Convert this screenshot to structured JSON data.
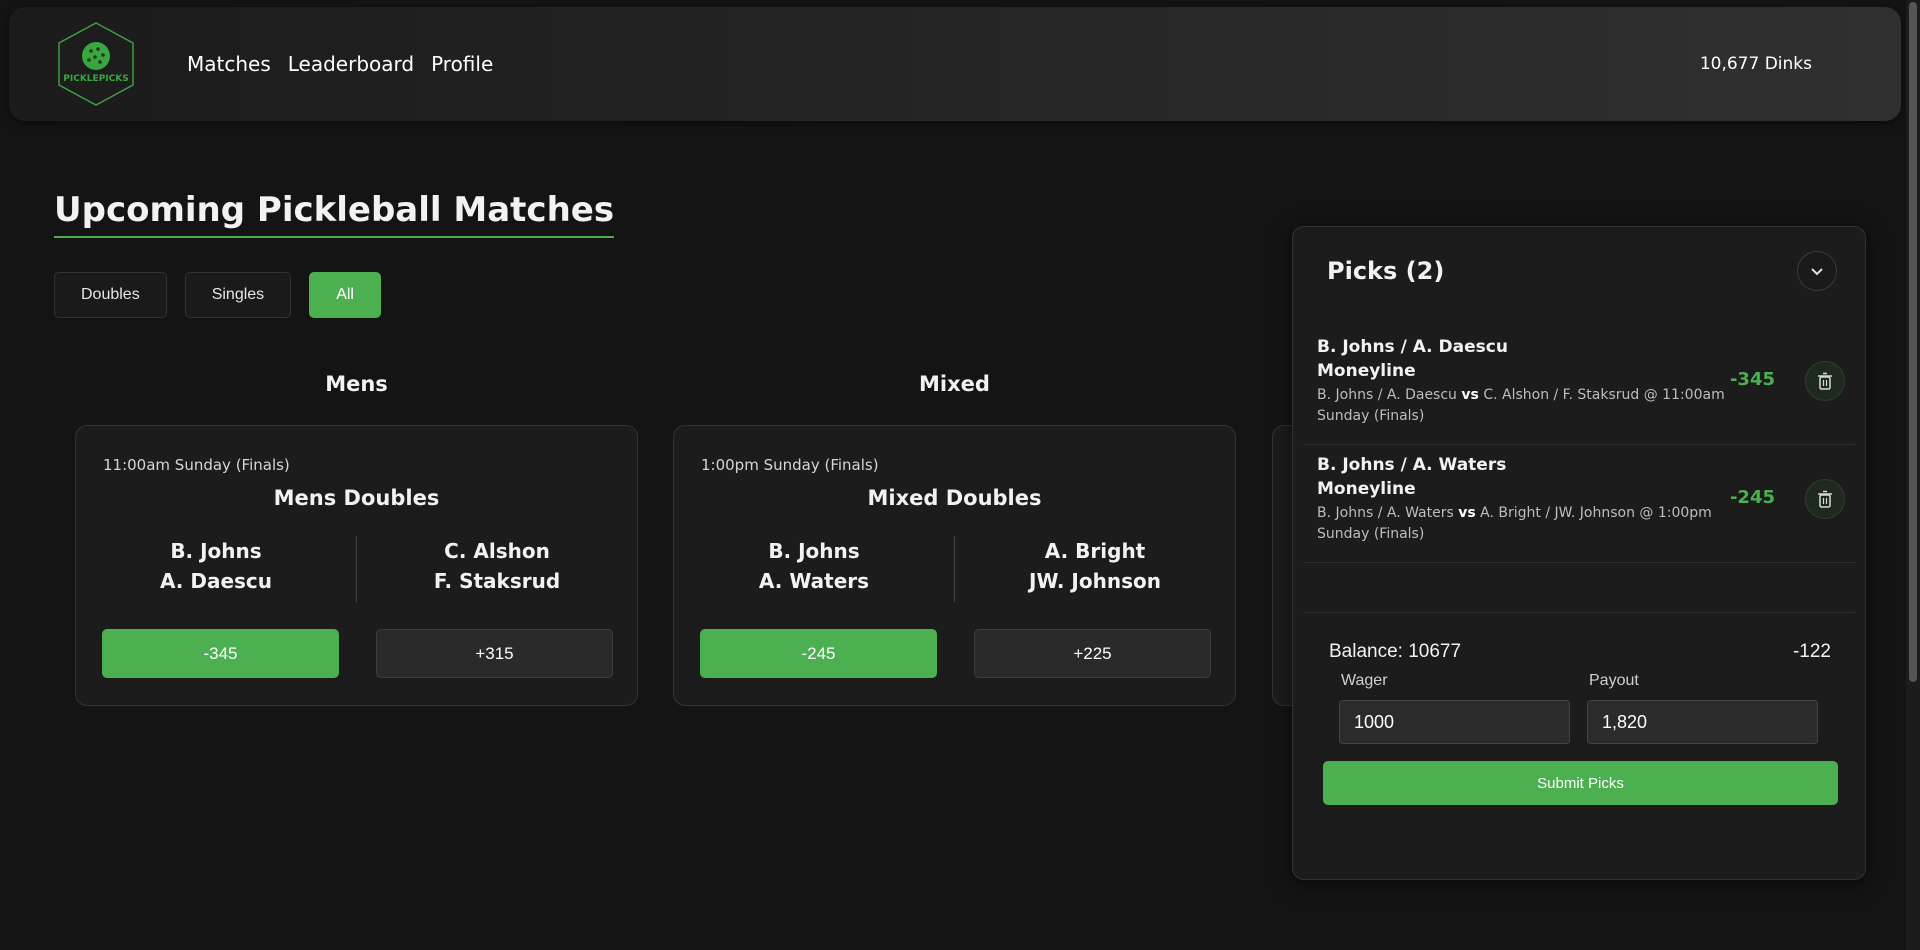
{
  "header": {
    "logo_text": "PICKLEPICKS",
    "nav": [
      "Matches",
      "Leaderboard",
      "Profile"
    ],
    "balance": "10,677 Dinks"
  },
  "page": {
    "title": "Upcoming Pickleball Matches",
    "filters": [
      "Doubles",
      "Singles",
      "All"
    ],
    "active_filter": "All"
  },
  "columns": [
    "Mens",
    "Mixed"
  ],
  "matches": [
    {
      "time": "11:00am Sunday (Finals)",
      "title": "Mens Doubles",
      "team1": [
        "B. Johns",
        "A. Daescu"
      ],
      "team2": [
        "C. Alshon",
        "F. Staksrud"
      ],
      "odds1": "-345",
      "odds2": "+315",
      "selected": 1
    },
    {
      "time": "1:00pm Sunday (Finals)",
      "title": "Mixed Doubles",
      "team1": [
        "B. Johns",
        "A. Waters"
      ],
      "team2": [
        "A. Bright",
        "JW. Johnson"
      ],
      "odds1": "-245",
      "odds2": "+225",
      "selected": 1
    }
  ],
  "picks": {
    "title": "Picks (2)",
    "items": [
      {
        "team": "B. Johns / A. Daescu",
        "market": "Moneyline",
        "desc_a": "B. Johns / A. Daescu",
        "vs": "vs",
        "desc_b": "C. Alshon / F. Staksrud @ 11:00am Sunday (Finals)",
        "odds": "-345"
      },
      {
        "team": "B. Johns / A. Waters",
        "market": "Moneyline",
        "desc_a": "B. Johns / A. Waters",
        "vs": "vs",
        "desc_b": "A. Bright / JW. Johnson @ 1:00pm Sunday (Finals)",
        "odds": "-245"
      }
    ],
    "balance_label": "Balance: 10677",
    "combined_odds": "-122",
    "wager_label": "Wager",
    "payout_label": "Payout",
    "wager_value": "1000",
    "payout_value": "1,820",
    "submit_label": "Submit Picks"
  },
  "colors": {
    "accent": "#4caf50",
    "background": "#141414",
    "card": "#1c1c1c"
  }
}
